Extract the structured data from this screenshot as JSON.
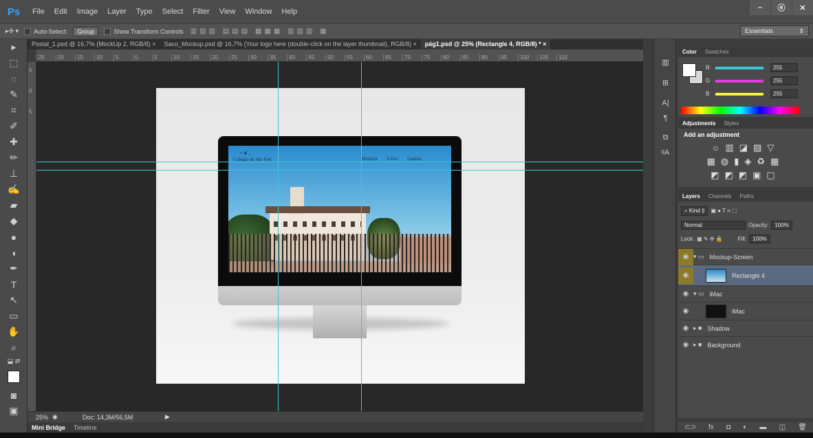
{
  "app": {
    "logo": "Ps"
  },
  "menu": [
    "File",
    "Edit",
    "Image",
    "Layer",
    "Type",
    "Select",
    "Filter",
    "View",
    "Window",
    "Help"
  ],
  "window_buttons": {
    "minimize": "–",
    "restore": "ⓔ",
    "close": "✕"
  },
  "options": {
    "auto_select_label": "Auto-Select:",
    "group_value": "Group",
    "transform_label": "Show Transform Controls",
    "workspace": "Essentials"
  },
  "tabs": [
    "Postal_1.psd @ 16,7% (MockUp 2, RGB/8)",
    "Saco_Mockup.psd @ 16,7% (Your logo here (double-click on the layer thumbnail), RGB/8)",
    "pág1.psd @ 25% (Rectangle 4, RGB/8) *"
  ],
  "ruler_h": [
    "25",
    "20",
    "15",
    "10",
    "5",
    "0",
    "5",
    "10",
    "15",
    "20",
    "25",
    "30",
    "35",
    "40",
    "45",
    "50",
    "55",
    "60",
    "65",
    "70",
    "75",
    "80",
    "85",
    "90",
    "95",
    "100",
    "105",
    "110"
  ],
  "ruler_v": [
    "5",
    "0",
    "5"
  ],
  "website": {
    "logo": "Colégio de São Fiel",
    "nav": [
      "História",
      "Livro",
      "Galeria"
    ]
  },
  "status": {
    "zoom": "25%",
    "doc": "Doc: 14,3M/56,5M"
  },
  "bottom_tabs": [
    "Mini Bridge",
    "Timeline"
  ],
  "color_panel": {
    "tabs": [
      "Color",
      "Swatches"
    ],
    "channels": [
      {
        "label": "R",
        "value": "255",
        "color": "#41c4d4"
      },
      {
        "label": "G",
        "value": "255",
        "color": "#e23de0"
      },
      {
        "label": "B",
        "value": "255",
        "color": "#f2f23a"
      }
    ]
  },
  "adjustments": {
    "tabs": [
      "Adjustments",
      "Styles"
    ],
    "title": "Add an adjustment"
  },
  "layers_panel": {
    "tabs": [
      "Layers",
      "Channels",
      "Paths"
    ],
    "kind": "Kind",
    "blend": "Normal",
    "opacity_label": "Opacity:",
    "opacity": "100%",
    "lock_label": "Lock:",
    "fill_label": "Fill:",
    "fill": "100%",
    "layers": [
      {
        "name": "Mockup-Screen",
        "type": "group",
        "expanded": true,
        "highlight": true
      },
      {
        "name": "Rectangle 4",
        "type": "layer",
        "thumb": "sky",
        "selected": true,
        "highlight": true
      },
      {
        "name": "iMac",
        "type": "group",
        "expanded": true
      },
      {
        "name": "iMac",
        "type": "layer",
        "thumb": "dark"
      },
      {
        "name": "Shadow",
        "type": "group",
        "expanded": false
      },
      {
        "name": "Background",
        "type": "group",
        "expanded": false
      }
    ]
  }
}
